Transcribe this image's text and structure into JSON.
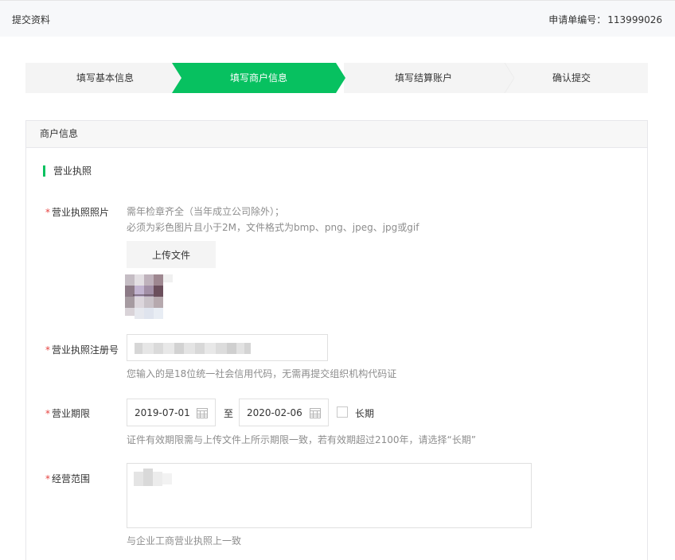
{
  "header": {
    "title": "提交资料",
    "application_no_label": "申请单编号：",
    "application_no": "113999026"
  },
  "steps": [
    {
      "label": "填写基本信息",
      "state": "done"
    },
    {
      "label": "填写商户信息",
      "state": "active"
    },
    {
      "label": "填写结算账户",
      "state": "pending"
    },
    {
      "label": "确认提交",
      "state": "pending"
    }
  ],
  "panel": {
    "title": "商户信息",
    "section_title": "营业执照"
  },
  "form": {
    "license_photo": {
      "label": "营业执照照片",
      "hint_line1": "需年检章齐全（当年成立公司除外）；",
      "hint_line2": "必须为彩色图片且小于2M，文件格式为bmp、png、jpeg、jpg或gif",
      "upload_button": "上传文件"
    },
    "license_number": {
      "label": "营业执照注册号",
      "hint": "您输入的是18位统一社会信用代码，无需再提交组织机构代码证"
    },
    "validity": {
      "label": "营业期限",
      "start_date": "2019-07-01",
      "separator": "至",
      "end_date": "2020-02-06",
      "long_term_label": "长期",
      "long_term_checked": false,
      "hint": "证件有效期限需与上传文件上所示期限一致，若有效期超过2100年，请选择“长期”"
    },
    "business_scope": {
      "label": "经营范围",
      "hint": "与企业工商营业执照上一致"
    },
    "required_mark": "*"
  },
  "colors": {
    "accent": "#07c160",
    "required": "#e64340",
    "hint": "#8d8d8d"
  }
}
